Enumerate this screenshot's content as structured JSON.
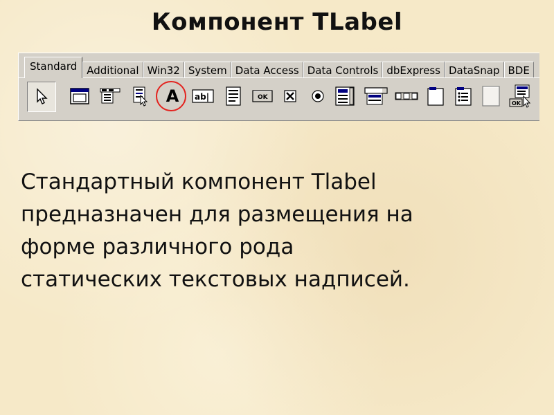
{
  "slide": {
    "title": "Компонент TLabel",
    "body_lines": [
      "Стандартный компонент Tlabel",
      "предназначен для размещения на",
      "форме различного рода",
      "статических текстовых надписей."
    ]
  },
  "palette": {
    "tabs": [
      "Standard",
      "Additional",
      "Win32",
      "System",
      "Data Access",
      "Data Controls",
      "dbExpress",
      "DataSnap",
      "BDE"
    ],
    "active_tab": "Standard",
    "label_glyph": "A",
    "edit_glyph": "ab|",
    "button_glyph": "OK",
    "checkbox_glyph": "✕",
    "actionlist_glyph": "OK",
    "highlighted_component": "label-component",
    "highlight_color": "#e3221e"
  }
}
